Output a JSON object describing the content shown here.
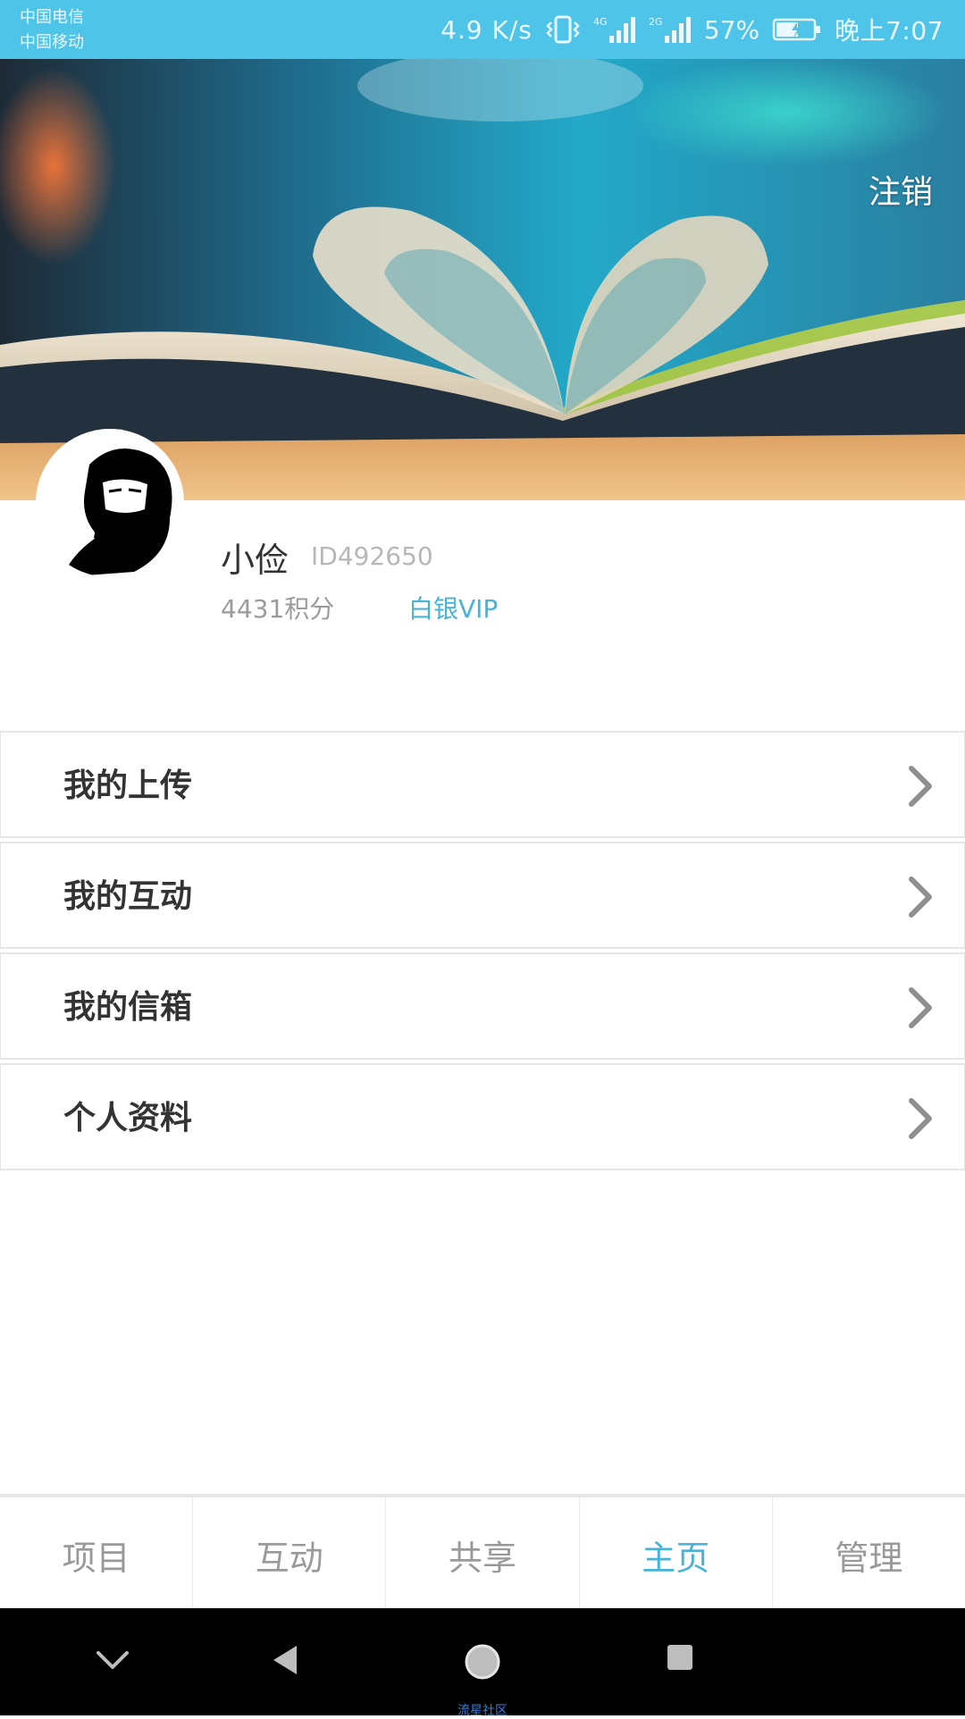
{
  "status_bar": {
    "carrier_1": "中国电信",
    "carrier_2": "中国移动",
    "net_speed": "4.9 K/s",
    "network_4g": "4G",
    "network_2g": "2G",
    "battery": "57%",
    "time": "晚上7:07"
  },
  "header": {
    "logout_label": "注销"
  },
  "profile": {
    "username": "小俭",
    "user_id": "ID492650",
    "points": "4431积分",
    "vip_level": "白银VIP"
  },
  "menu": {
    "items": [
      {
        "label": "我的上传"
      },
      {
        "label": "我的互动"
      },
      {
        "label": "我的信箱"
      },
      {
        "label": "个人资料"
      }
    ]
  },
  "tabs": {
    "items": [
      {
        "label": "项目"
      },
      {
        "label": "互动"
      },
      {
        "label": "共享"
      },
      {
        "label": "主页"
      },
      {
        "label": "管理"
      }
    ],
    "active_index": 3
  },
  "watermark": "流星社区",
  "colors": {
    "status_bar": "#4ec4e8",
    "accent": "#47b3d6",
    "nav_bar": "#000000"
  }
}
